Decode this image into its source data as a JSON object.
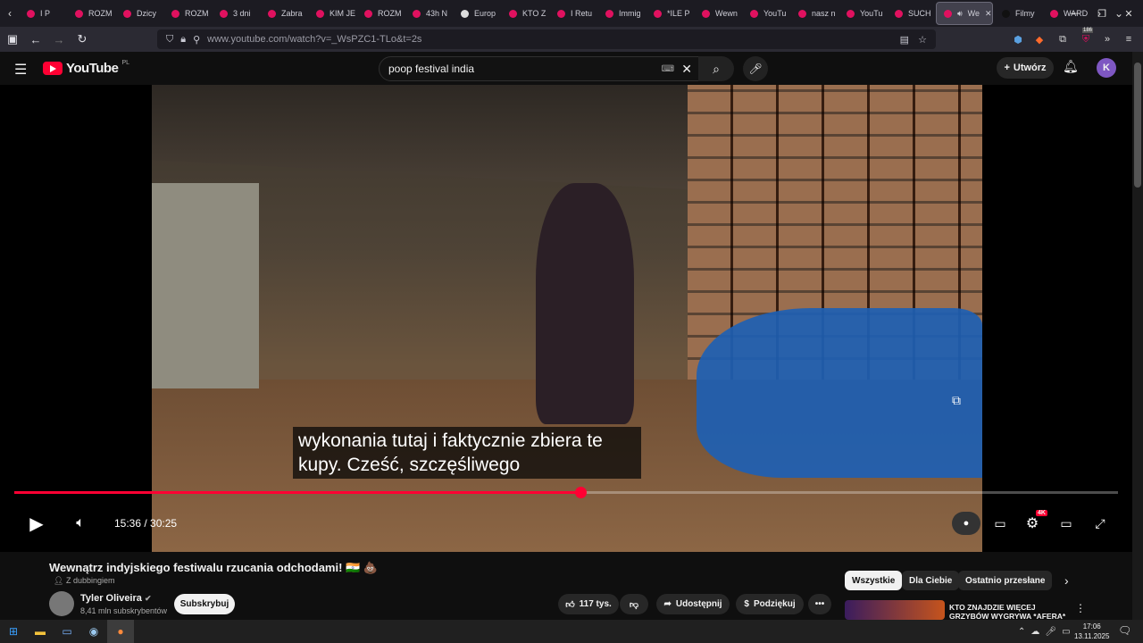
{
  "browser": {
    "tabs": [
      {
        "label": "I P"
      },
      {
        "label": "ROZM"
      },
      {
        "label": "Dzicy"
      },
      {
        "label": "ROZM"
      },
      {
        "label": "3 dni"
      },
      {
        "label": "Zabra"
      },
      {
        "label": "KIM JE"
      },
      {
        "label": "ROZM"
      },
      {
        "label": "43h N"
      },
      {
        "label": "Europ"
      },
      {
        "label": "KTO Z"
      },
      {
        "label": "I Retu"
      },
      {
        "label": "Immig"
      },
      {
        "label": "*ILE P"
      },
      {
        "label": "Wewn"
      },
      {
        "label": "YouTu"
      },
      {
        "label": "nasz n"
      },
      {
        "label": "YouTu"
      },
      {
        "label": "SUCH"
      },
      {
        "label": "We"
      },
      {
        "label": "Filmy"
      },
      {
        "label": "WARD"
      }
    ],
    "url": "www.youtube.com/watch?v=_WsPZC1-TLo&t=2s",
    "badge_count": "186"
  },
  "youtube": {
    "logo_text": "YouTube",
    "region": "PL",
    "search_query": "poop festival india",
    "create_label": "Utwórz",
    "avatar_letter": "K"
  },
  "player": {
    "subtitle_line1": "wykonania tutaj i faktycznie zbiera te",
    "subtitle_line2": "kupy. Cześć, szczęśliwego",
    "current_time": "15:36",
    "separator": " / ",
    "duration": "30:25",
    "progress_fraction": 0.513,
    "quality_badge": "4K"
  },
  "video": {
    "title": "Wewnątrz indyjskiego festiwalu rzucania odchodami! 🇮🇳 💩",
    "dubbing": "Z dubbingiem",
    "channel": "Tyler Oliveira",
    "subscribers": "8,41 mln subskrybentów",
    "subscribe_label": "Subskrybuj",
    "likes": "117 tys.",
    "share_label": "Udostępnij",
    "thanks_label": "Podziękuj"
  },
  "chips": [
    "Wszystkie",
    "Dla Ciebie",
    "Ostatnio przesłane"
  ],
  "recommendation": {
    "title": "KTO ZNAJDZIE WIĘCEJ GRZYBÓW WYGRYWA *AFERA*"
  },
  "taskbar": {
    "time": "17:06",
    "date": "13.11.2025"
  }
}
